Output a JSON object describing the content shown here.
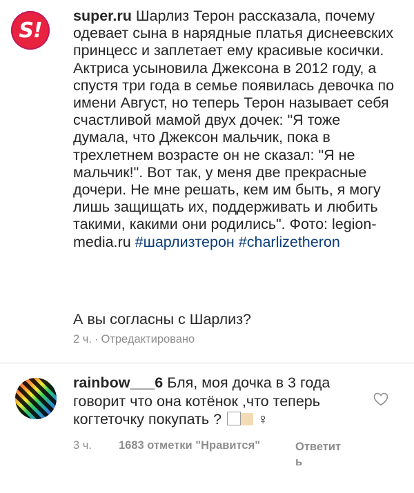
{
  "post": {
    "avatar_text": "S!",
    "username": "super.ru",
    "text": "Шарлиз Терон рассказала, почему одевает сына в нарядные платья диснеевских принцесс и заплетает ему красивые косички. Актриса усыновила Джексона в 2012 году, а спустя три года в семье появилась девочка по имени Август, но теперь Терон называет себя счастливой мамой двух дочек: \"Я тоже думала, что Джексон мальчик, пока в трехлетнем возрасте он не сказал: \"Я не мальчик!\". Вот так, у меня две прекрасные дочери. Не мне решать, кем им быть, я могу лишь защищать их, поддерживать и любить такими, какими они родились\". Фото: legion-media.ru",
    "hashtag1": "#шарлизтерон",
    "hashtag2": "#charlizetheron",
    "question": "А вы согласны с Шарлиз?",
    "time": "2 ч.",
    "separator": "·",
    "edited": "Отредактировано"
  },
  "comment": {
    "username": "rainbow___6",
    "text": "Бля, моя дочка в 3 года говорит что она котёнок ,что теперь когтеточку покупать ?",
    "gender_symbol": "♀",
    "time": "3 ч.",
    "likes": "1683 отметки \"Нравится\"",
    "reply": "Ответить"
  },
  "colors": {
    "brand_red": "#e8233f",
    "hashtag": "#0b3d7a",
    "meta_gray": "#8e8e8e",
    "divider": "#dbdbdb"
  },
  "icons": {
    "like": "heart-outline-icon"
  }
}
